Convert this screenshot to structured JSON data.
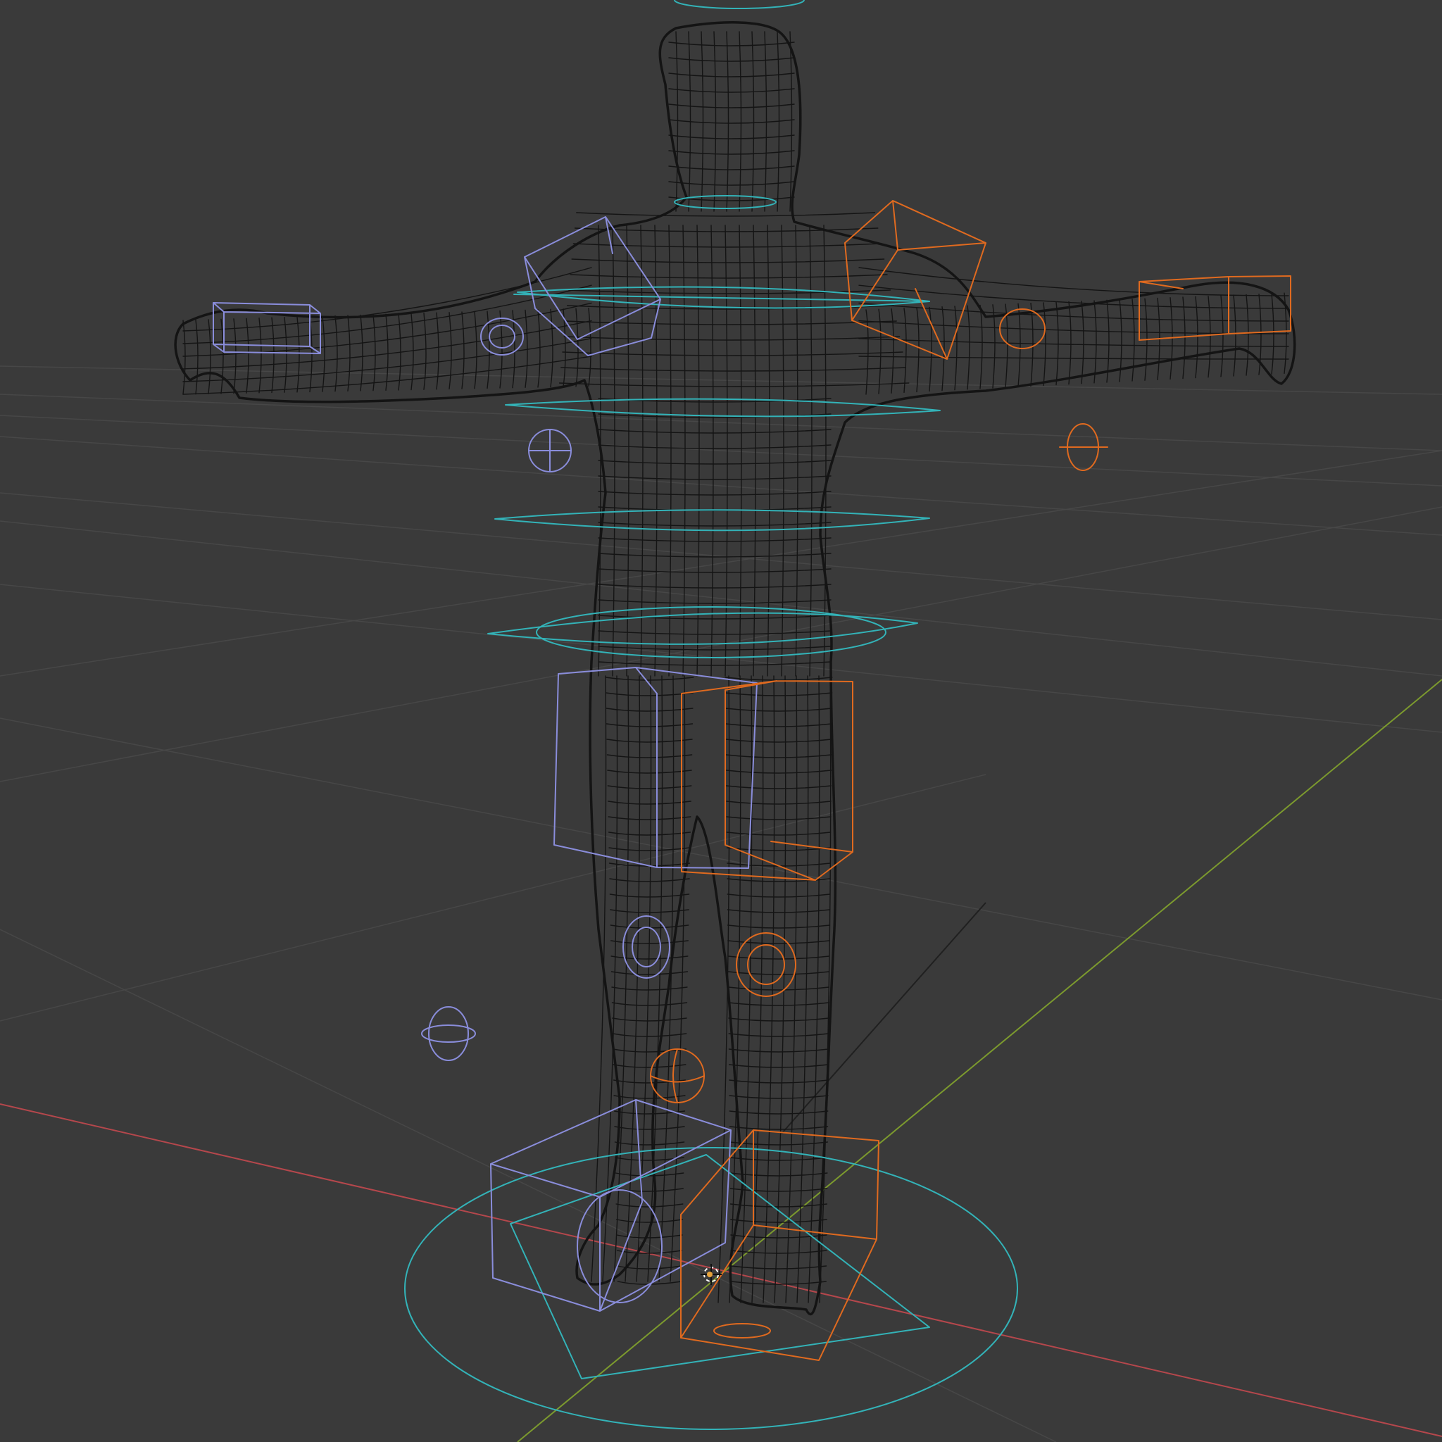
{
  "viewport": {
    "background_color": "#3a3a3a",
    "grid_color": "#474747",
    "x_axis_color": "#b5474c",
    "y_axis_color": "#7c9a2e",
    "mesh_color": "#141414",
    "shading": "wireframe",
    "pose": "T-pose"
  },
  "rig": {
    "center_color": "#33b3b8",
    "left_color": "#8a8ddb",
    "right_color": "#e06a1f",
    "shapes": [
      "circle",
      "cube",
      "sphere",
      "ring",
      "diamond"
    ]
  },
  "icons": [
    "3d-cursor-icon",
    "origin-point-icon"
  ]
}
